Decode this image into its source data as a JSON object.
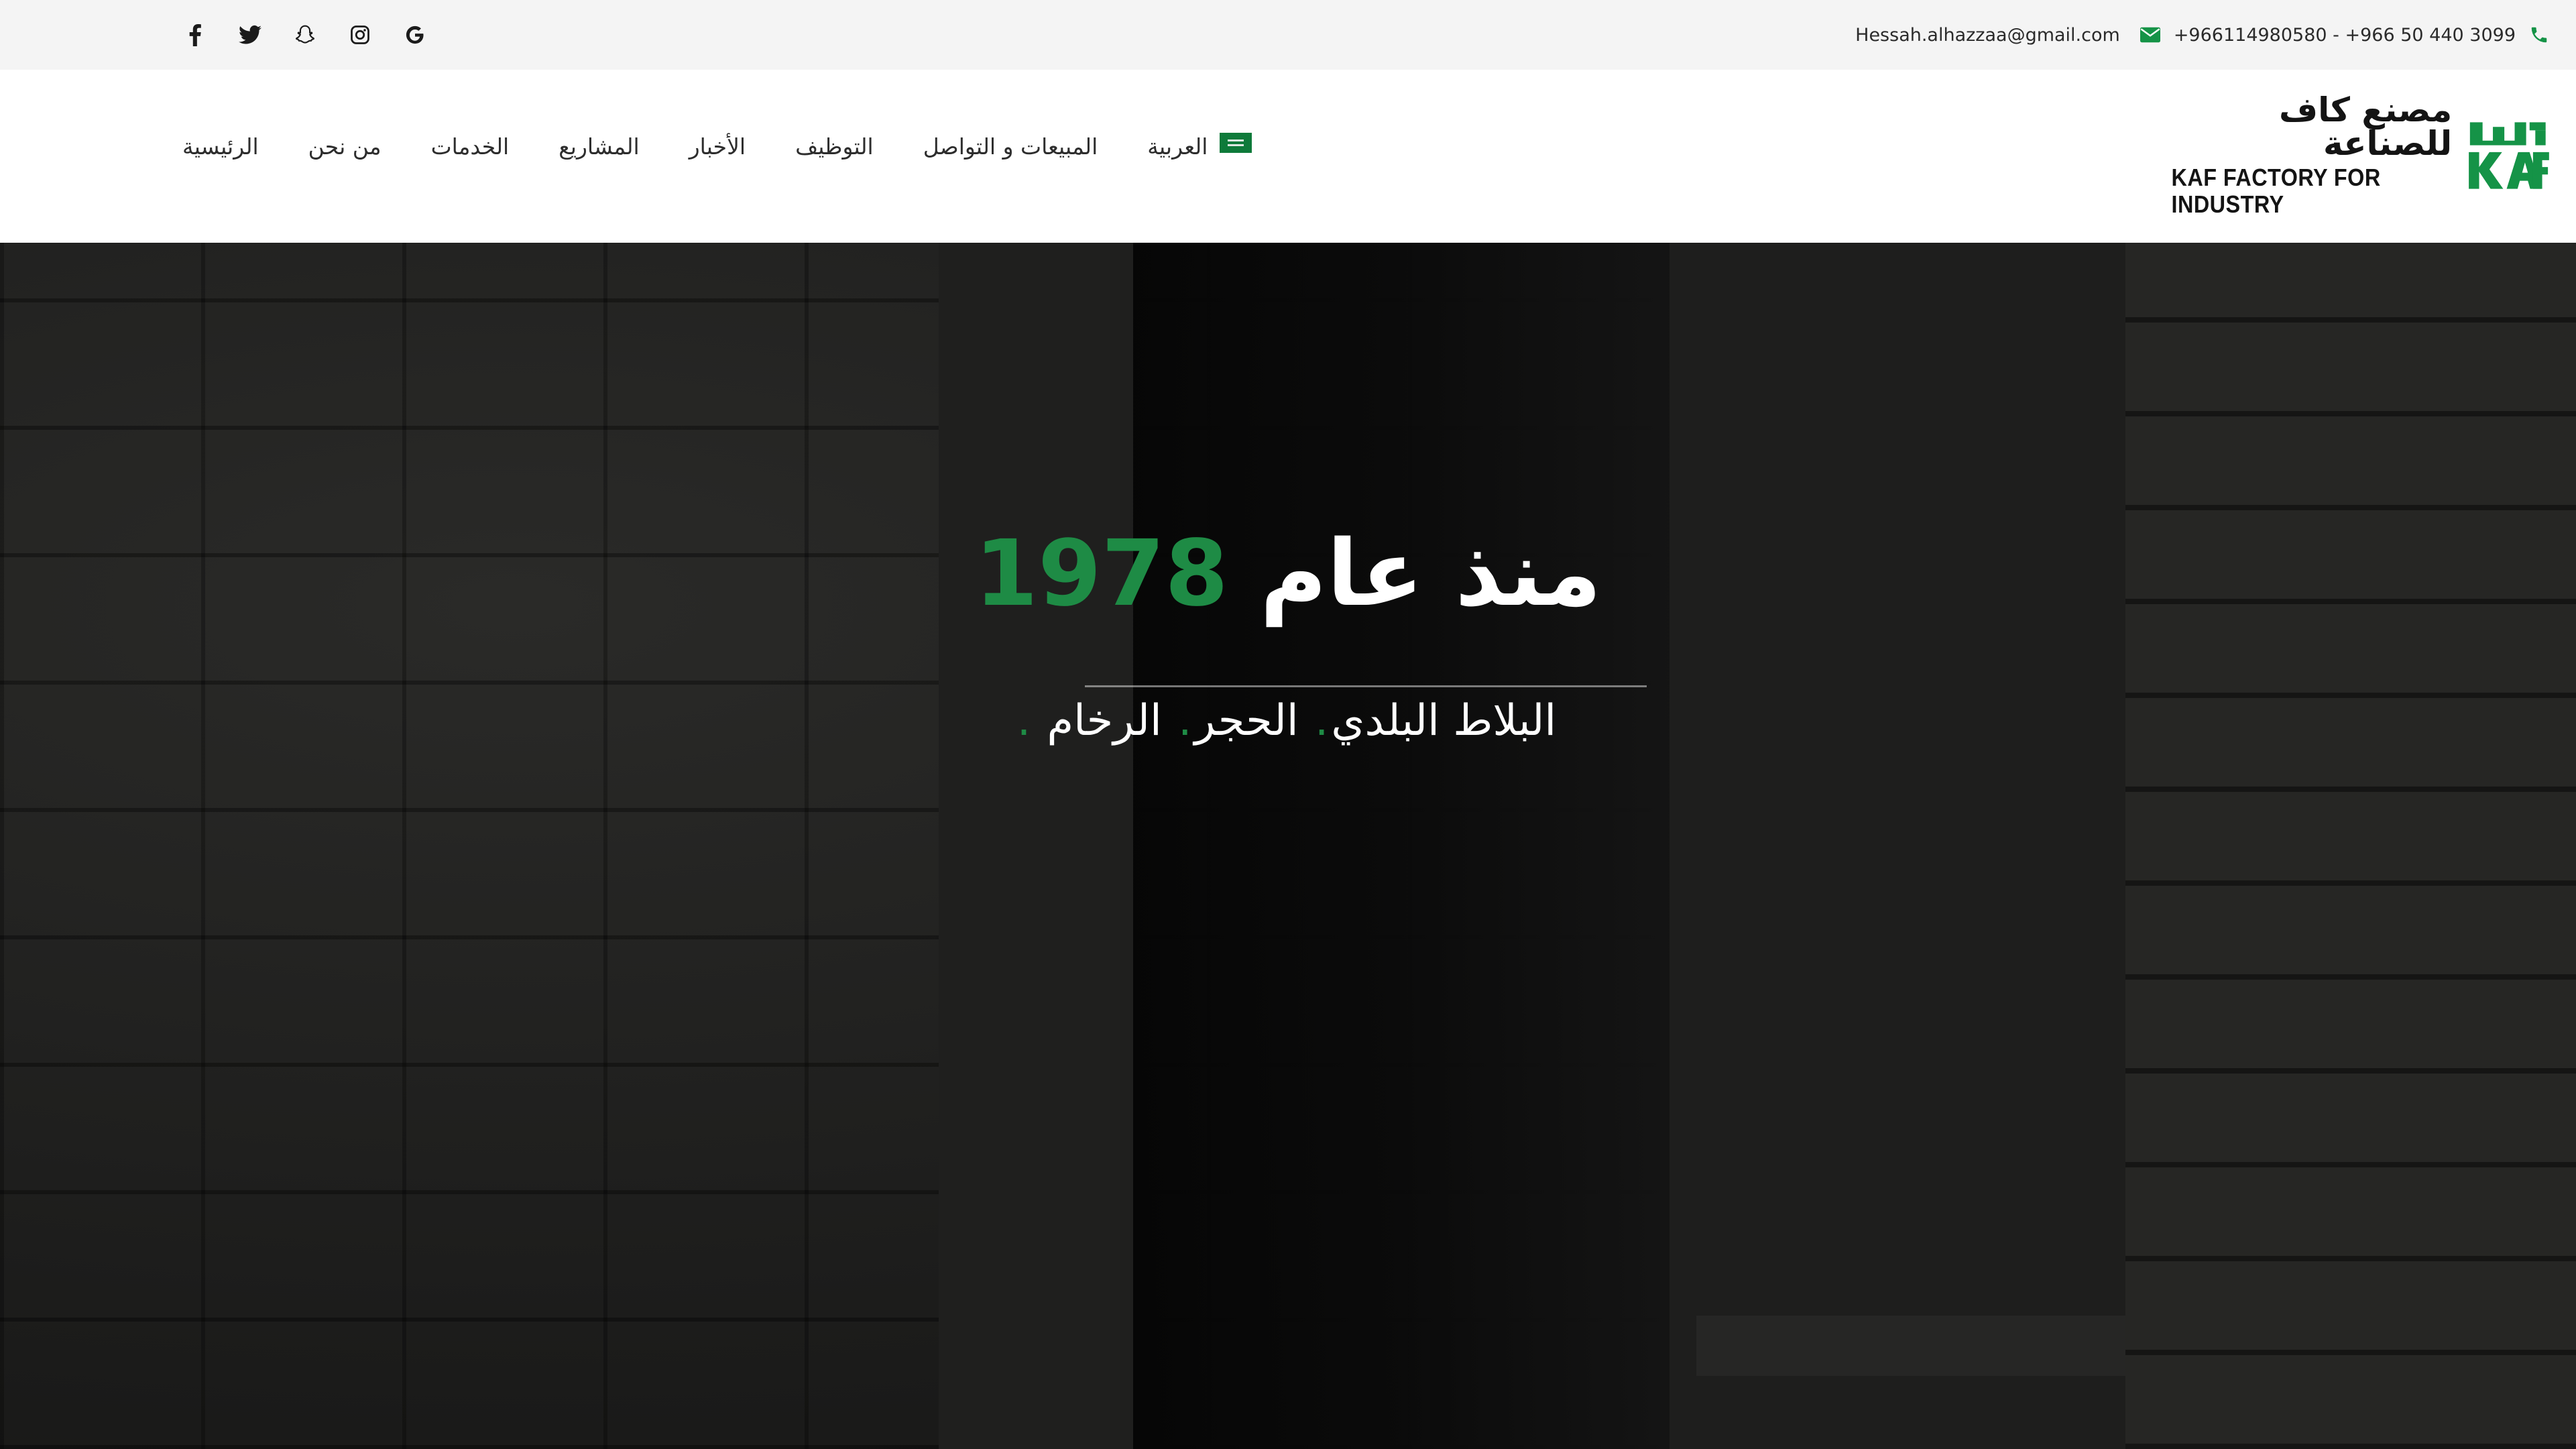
{
  "topbar": {
    "phone": "+966114980580 - +966 50 440 3099",
    "email": "Hessah.alhazzaa@gmail.com",
    "social": [
      {
        "icon": "facebook-icon"
      },
      {
        "icon": "twitter-icon"
      },
      {
        "icon": "snapchat-icon"
      },
      {
        "icon": "instagram-icon"
      },
      {
        "icon": "google-icon"
      }
    ]
  },
  "logo": {
    "arabic": "مصنع كاف للصناعة",
    "english": "KAF FACTORY FOR INDUSTRY",
    "mark": "KAF",
    "brand_color": "#159347"
  },
  "nav": {
    "items": [
      "الرئيسية",
      "من نحن",
      "الخدمات",
      "المشاريع",
      "الأخبار",
      "التوظيف",
      "المبيعات و التواصل"
    ],
    "language": "العربية"
  },
  "hero": {
    "title_prefix": "منذ عام",
    "title_year": "1978",
    "subtitle_items": [
      "البلاط البلدي",
      "الحجر",
      "الرخام"
    ],
    "separator": ".",
    "accent_color": "#1e8b45"
  }
}
